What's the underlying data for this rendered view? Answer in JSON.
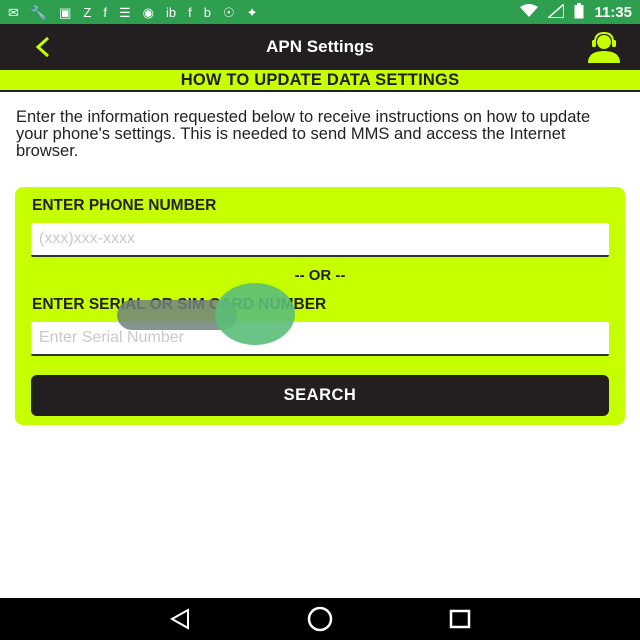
{
  "status_bar": {
    "time": "11:35",
    "icons": [
      "messenger-icon",
      "wrench-icon",
      "bbm-icon",
      "signal-z-icon",
      "facebook-icon",
      "list-icon",
      "voicemail-icon",
      "ib-icon",
      "facebook-icon",
      "b-icon",
      "unknown-icon",
      "satellite-icon",
      "wifi-icon",
      "signal-icon",
      "battery-icon"
    ],
    "background_color": "#2e9e4f"
  },
  "app_bar": {
    "title": "APN Settings",
    "background_color": "#231f20",
    "accent_color": "#c6ff00"
  },
  "banner": {
    "text": "HOW TO UPDATE DATA SETTINGS"
  },
  "intro": {
    "text": "Enter the information requested below to receive instructions on how to update your phone's settings. This is needed to send MMS and access the Internet browser."
  },
  "form": {
    "phone_label": "ENTER PHONE NUMBER",
    "phone_placeholder": "(xxx)xxx-xxxx",
    "phone_value": "",
    "or_text": "-- OR --",
    "serial_label": "ENTER SERIAL OR SIM CARD NUMBER",
    "serial_placeholder": "Enter Serial Number",
    "serial_value": "",
    "search_label": "SEARCH"
  },
  "nav_bar": {
    "buttons": [
      "back-triangle-icon",
      "home-circle-icon",
      "recents-square-icon"
    ]
  }
}
